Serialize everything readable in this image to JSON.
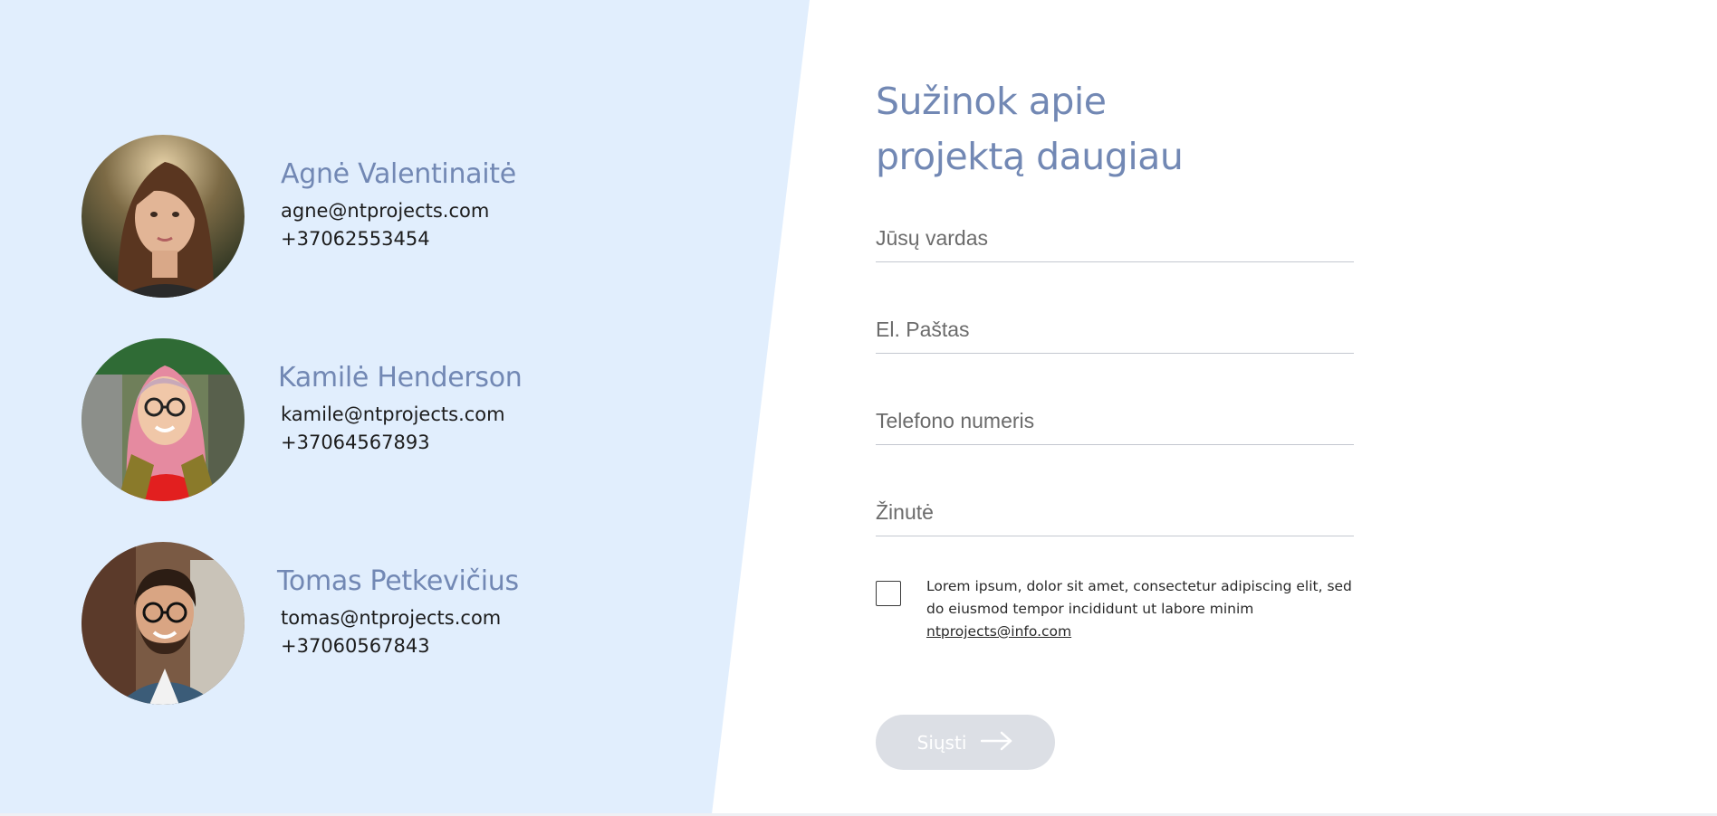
{
  "contacts": [
    {
      "name": "Agnė Valentinaitė",
      "email": "agne@ntprojects.com",
      "phone": "+37062553454"
    },
    {
      "name": "Kamilė Henderson",
      "email": "kamile@ntprojects.com",
      "phone": "+37064567893"
    },
    {
      "name": "Tomas Petkevičius",
      "email": "tomas@ntprojects.com",
      "phone": "+37060567843"
    }
  ],
  "form": {
    "title_line1": "Sužinok apie",
    "title_line2": "projektą daugiau",
    "name_placeholder": "Jūsų vardas",
    "email_placeholder": "El. Paštas",
    "phone_placeholder": "Telefono numeris",
    "message_placeholder": "Žinutė",
    "consent_text": "Lorem ipsum, dolor sit amet, consectetur adipiscing elit, sed do eiusmod tempor incididunt ut labore minim",
    "consent_link": "ntprojects@info.com",
    "submit_label": "Siųsti"
  },
  "colors": {
    "left_panel": "#e1eefd",
    "accent": "#7288b4",
    "button_bg": "#dcdfe5"
  },
  "icons": {
    "submit": "arrow-right-icon"
  }
}
